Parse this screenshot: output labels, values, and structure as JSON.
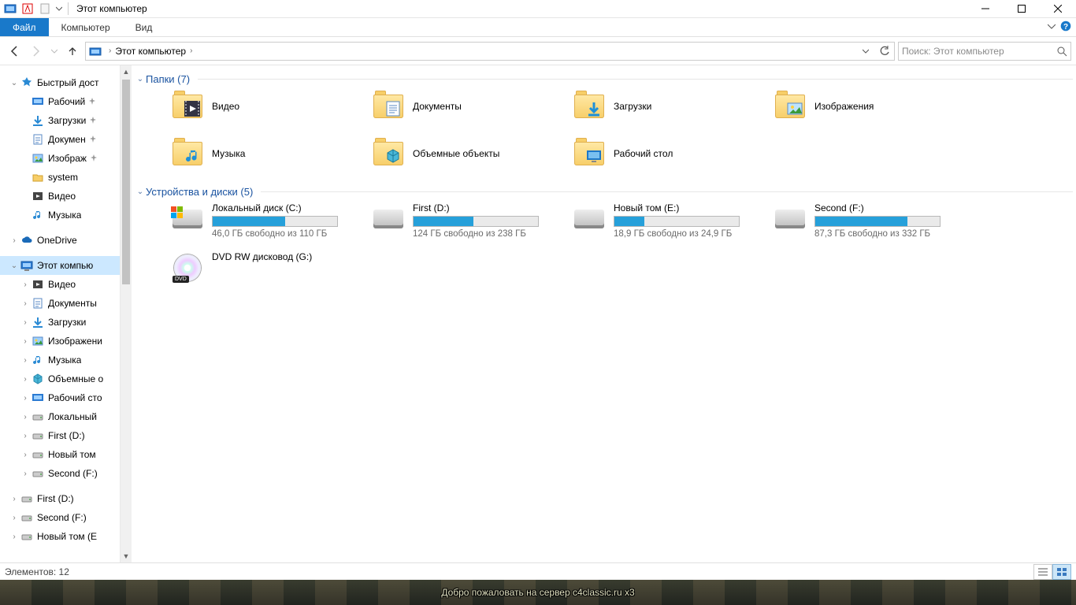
{
  "window": {
    "title": "Этот компьютер"
  },
  "ribbon": {
    "file": "Файл",
    "tab1": "Компьютер",
    "tab2": "Вид"
  },
  "address": {
    "root": "Этот компьютер"
  },
  "search": {
    "placeholder": "Поиск: Этот компьютер"
  },
  "sidebar": {
    "quick": "Быстрый дост",
    "quick_items": [
      "Рабочий ",
      "Загрузки",
      "Докумен",
      "Изображ",
      "system",
      "Видео",
      "Музыка"
    ],
    "onedrive": "OneDrive",
    "thispc": "Этот компью",
    "thispc_items": [
      "Видео",
      "Документы",
      "Загрузки",
      "Изображени",
      "Музыка",
      "Объемные о",
      "Рабочий сто",
      "Локальный ",
      "First (D:)",
      "Новый том ",
      "Second (F:)"
    ],
    "extra": [
      "First (D:)",
      "Second (F:)",
      "Новый том (E"
    ]
  },
  "groups": {
    "folders": "Папки (7)",
    "drives": "Устройства и диски (5)"
  },
  "folders": [
    {
      "name": "Видео",
      "overlay": "video"
    },
    {
      "name": "Документы",
      "overlay": "doc"
    },
    {
      "name": "Загрузки",
      "overlay": "download"
    },
    {
      "name": "Изображения",
      "overlay": "picture"
    },
    {
      "name": "Музыка",
      "overlay": "music"
    },
    {
      "name": "Объемные объекты",
      "overlay": "3d"
    },
    {
      "name": "Рабочий стол",
      "overlay": "desktop"
    }
  ],
  "drives": [
    {
      "name": "Локальный диск (C:)",
      "sub": "46,0 ГБ свободно из 110 ГБ",
      "pct": 58,
      "win": true
    },
    {
      "name": "First (D:)",
      "sub": "124 ГБ свободно из 238 ГБ",
      "pct": 48
    },
    {
      "name": "Новый том (E:)",
      "sub": "18,9 ГБ свободно из 24,9 ГБ",
      "pct": 24
    },
    {
      "name": "Second (F:)",
      "sub": "87,3 ГБ свободно из 332 ГБ",
      "pct": 74
    },
    {
      "name": "DVD RW дисковод (G:)",
      "sub": "",
      "dvd": true
    }
  ],
  "status": {
    "count": "Элементов: 12"
  },
  "game": {
    "msg": "Добро пожаловать на сервер c4classic.ru x3"
  }
}
